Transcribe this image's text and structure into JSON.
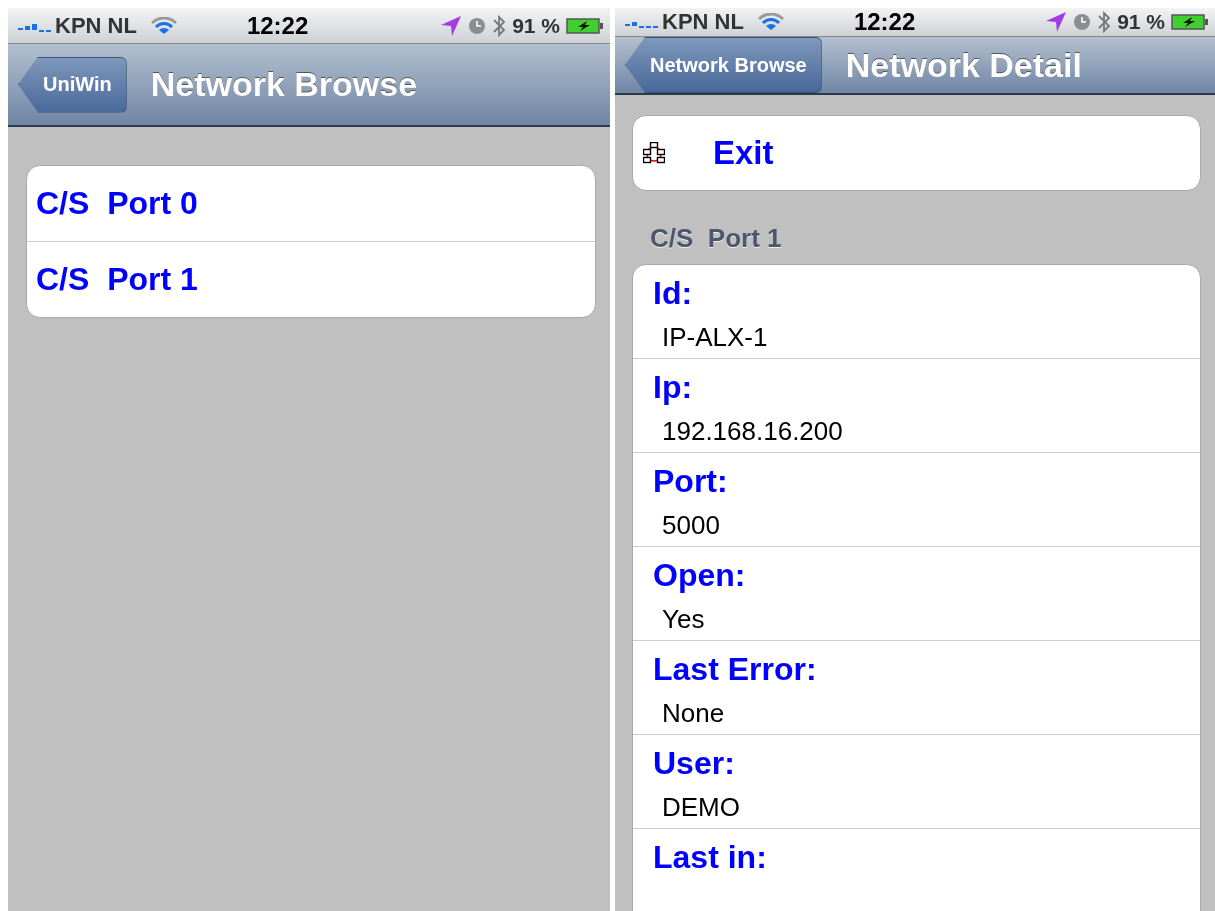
{
  "browse_screen": {
    "status_bar": {
      "carrier": "KPN NL",
      "time": "12:22",
      "battery": "91 %"
    },
    "nav_bar": {
      "back_button": "UniWin",
      "title": "Network Browse"
    },
    "ports": [
      {
        "label": "C/S  Port 0"
      },
      {
        "label": "C/S  Port 1"
      }
    ]
  },
  "detail_screen": {
    "status_bar": {
      "carrier": "KPN NL",
      "time": "12:22",
      "battery": "91 %"
    },
    "nav_bar": {
      "back_button": "Network Browse",
      "title": "Network Detail"
    },
    "exit_button": "Exit",
    "section_title": "C/S  Port 1",
    "fields": [
      {
        "label": "Id:",
        "value": "IP-ALX-1"
      },
      {
        "label": "Ip:",
        "value": "192.168.16.200"
      },
      {
        "label": "Port:",
        "value": "5000"
      },
      {
        "label": "Open:",
        "value": "Yes"
      },
      {
        "label": "Last Error:",
        "value": "None"
      },
      {
        "label": "User:",
        "value": "DEMO"
      },
      {
        "label": "Last in:"
      }
    ]
  }
}
